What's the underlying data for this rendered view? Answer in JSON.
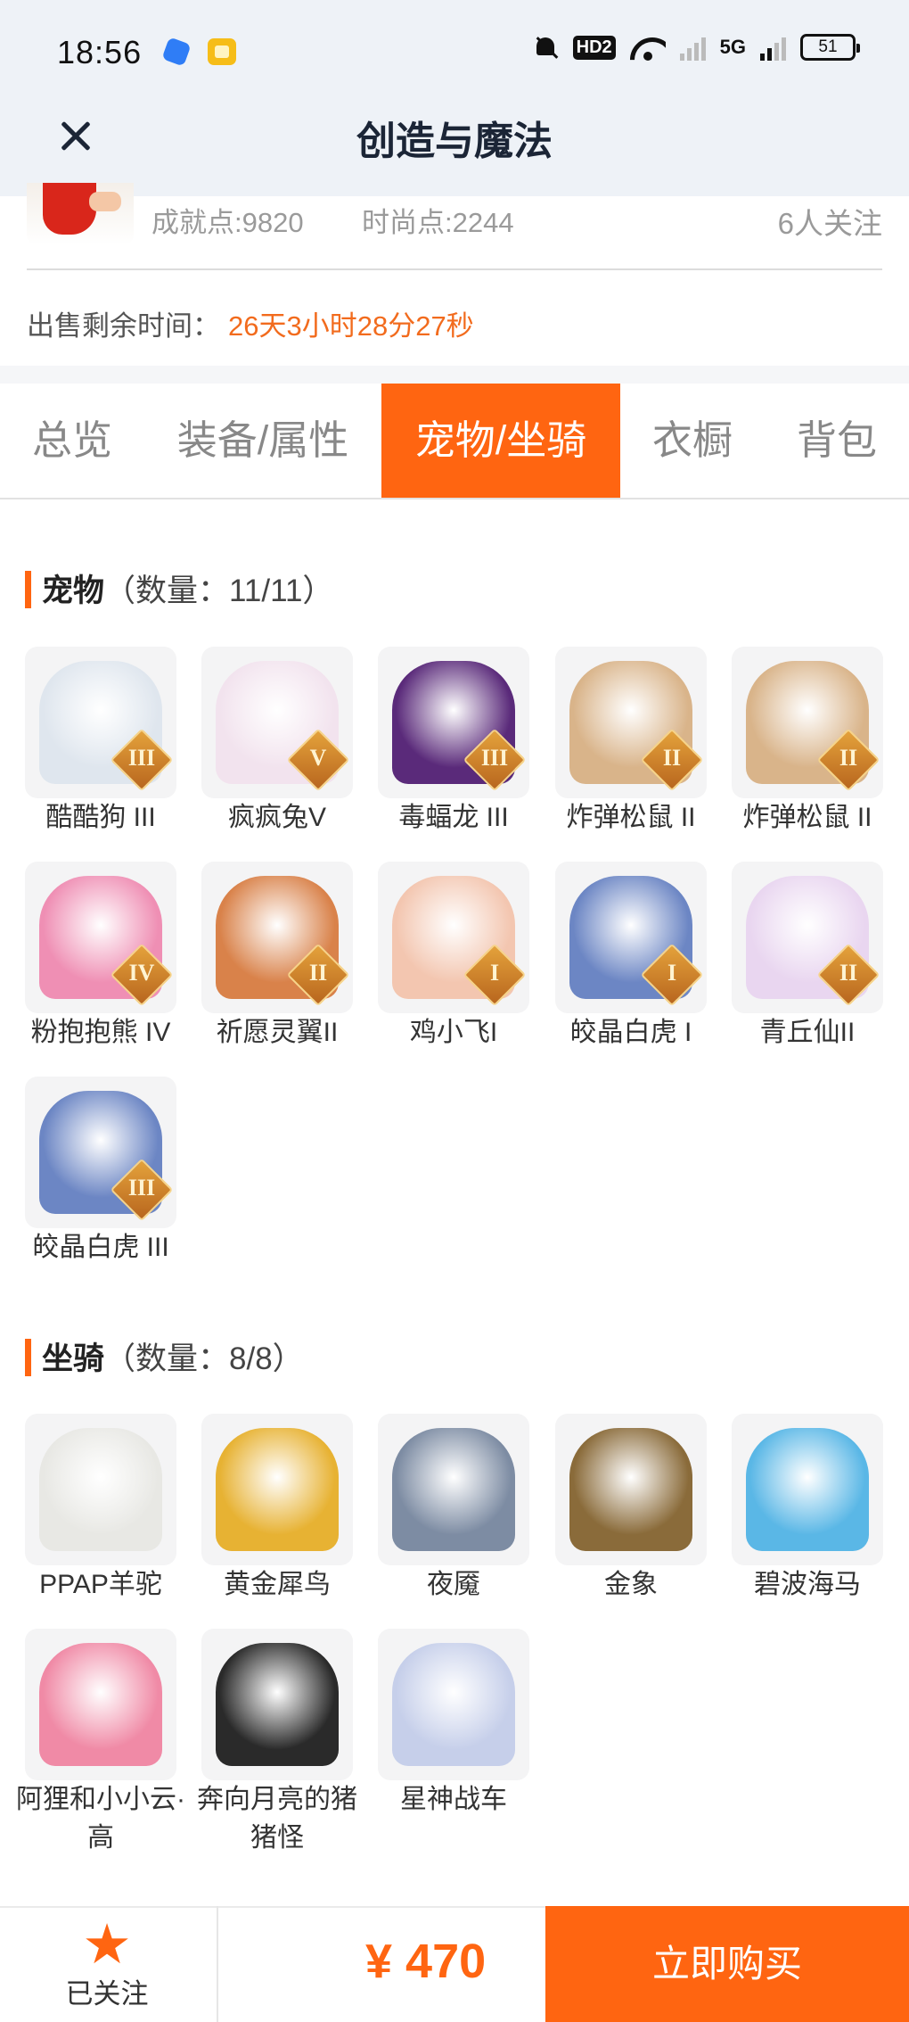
{
  "status_bar": {
    "time": "18:56",
    "hd_label": "HD2",
    "network_label": "5G",
    "battery": "51"
  },
  "nav": {
    "title": "创造与魔法"
  },
  "seller": {
    "achievement": "成就点:9820",
    "fashion": "时尚点:2244",
    "followers": "6人关注"
  },
  "sale": {
    "time_left_label": "出售剩余时间：",
    "time_left_value": "26天3小时28分27秒"
  },
  "tabs": [
    {
      "label": "总览",
      "active": false
    },
    {
      "label": "装备/属性",
      "active": false
    },
    {
      "label": "宠物/坐骑",
      "active": true
    },
    {
      "label": "衣橱",
      "active": false
    },
    {
      "label": "背包",
      "active": false
    }
  ],
  "pets": {
    "title": "宠物",
    "count": "（数量：11/11）",
    "items": [
      {
        "name": "酷酷狗 III",
        "tier": "III",
        "icon": "cool-dog-icon",
        "color": "#dfe6ee"
      },
      {
        "name": "疯疯兔V",
        "tier": "V",
        "icon": "crazy-rabbit-icon",
        "color": "#f2e3ee"
      },
      {
        "name": "毒蝠龙 III",
        "tier": "III",
        "icon": "poison-bat-dragon-icon",
        "color": "#5a2a7a"
      },
      {
        "name": "炸弹松鼠 II",
        "tier": "II",
        "icon": "bomb-squirrel-icon",
        "color": "#d9b48a"
      },
      {
        "name": "炸弹松鼠 II",
        "tier": "II",
        "icon": "bomb-squirrel-icon",
        "color": "#d9b48a"
      },
      {
        "name": "粉抱抱熊 IV",
        "tier": "IV",
        "icon": "pink-hug-bear-icon",
        "color": "#ef8fb4"
      },
      {
        "name": "祈愿灵翼II",
        "tier": "II",
        "icon": "wish-wing-icon",
        "color": "#d9824a"
      },
      {
        "name": "鸡小飞I",
        "tier": "I",
        "icon": "chicken-fly-icon",
        "color": "#f3c6b0"
      },
      {
        "name": "皎晶白虎 I",
        "tier": "I",
        "icon": "white-tiger-icon",
        "color": "#6c86c4"
      },
      {
        "name": "青丘仙II",
        "tier": "II",
        "icon": "qingqiu-fairy-icon",
        "color": "#e9d6f0"
      },
      {
        "name": "皎晶白虎 III",
        "tier": "III",
        "icon": "white-tiger-icon",
        "color": "#6c86c4"
      }
    ]
  },
  "mounts": {
    "title": "坐骑",
    "count": "（数量：8/8）",
    "items": [
      {
        "name": "PPAP羊驼",
        "icon": "alpaca-icon",
        "color": "#e8e8e4"
      },
      {
        "name": "黄金犀鸟",
        "icon": "golden-hornbill-icon",
        "color": "#e7b233"
      },
      {
        "name": "夜魇",
        "icon": "night-mare-icon",
        "color": "#7d8ca3"
      },
      {
        "name": "金象",
        "icon": "golden-elephant-icon",
        "color": "#8a6b3a"
      },
      {
        "name": "碧波海马",
        "icon": "seahorse-icon",
        "color": "#5ab7e6"
      },
      {
        "name": "阿狸和小小云·高",
        "icon": "ali-cloud-icon",
        "color": "#f08aa6"
      },
      {
        "name": "奔向月亮的猪猪怪",
        "icon": "moon-pig-icon",
        "color": "#2a2a2a"
      },
      {
        "name": "星神战车",
        "icon": "star-chariot-icon",
        "color": "#c6cfea"
      }
    ]
  },
  "bottom": {
    "follow_label": "已关注",
    "price": "¥ 470",
    "buy_label": "立即购买"
  }
}
